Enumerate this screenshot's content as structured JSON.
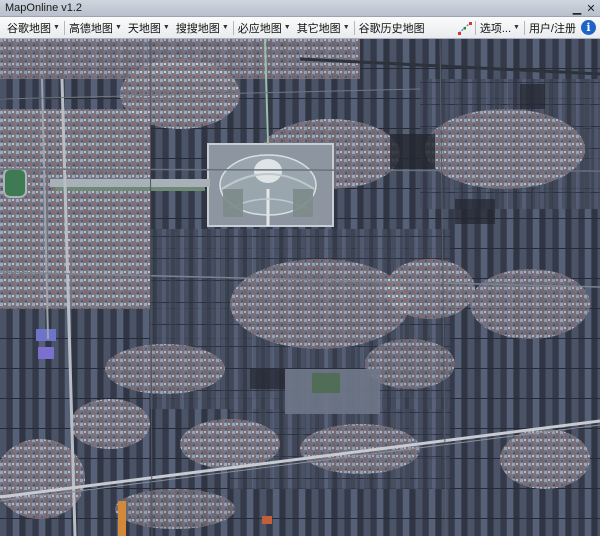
{
  "window": {
    "title": "MapOnline v1.2",
    "min_glyph": "▁",
    "close_glyph": "✕"
  },
  "toolbar": {
    "menus": [
      {
        "label": "谷歌地图"
      },
      {
        "label": "高德地图"
      },
      {
        "label": "天地图"
      },
      {
        "label": "搜搜地图"
      },
      {
        "label": "必应地图"
      },
      {
        "label": "其它地图"
      },
      {
        "label": "谷歌历史地图"
      }
    ],
    "options_label": "选项...",
    "account_label": "用户/注册",
    "info_glyph": "i"
  },
  "colors": {
    "accent": "#1e63c7",
    "map_base": "#3b4252"
  },
  "map": {
    "type": "satellite imagery",
    "alt": "Satellite view of farmland, villages and a ceremonial plaza"
  }
}
